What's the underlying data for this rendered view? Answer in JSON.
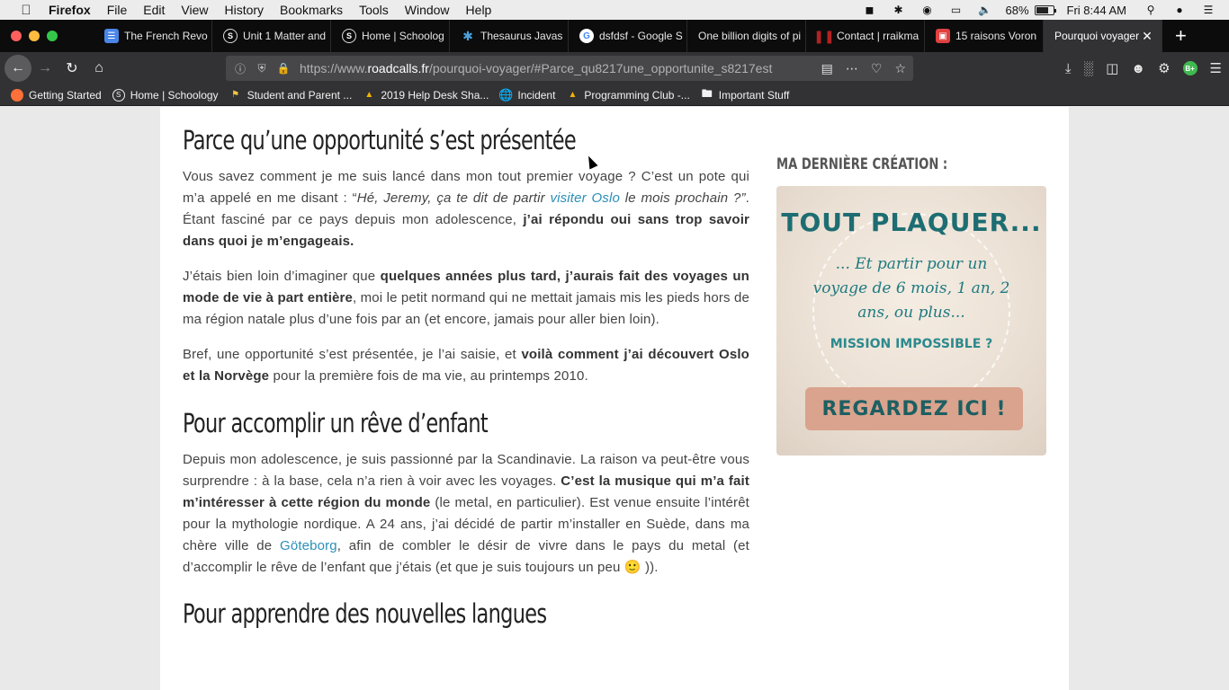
{
  "menubar": {
    "app": "Firefox",
    "items": [
      "File",
      "Edit",
      "View",
      "History",
      "Bookmarks",
      "Tools",
      "Window",
      "Help"
    ],
    "battery": "68%",
    "clock": "Fri 8:44 AM"
  },
  "tabs": [
    {
      "label": "The French Revo",
      "icon": "docs-icon",
      "color": "#4a86e8"
    },
    {
      "label": "Unit 1 Matter and",
      "icon": "schoology-icon",
      "color": "#3b3b3e"
    },
    {
      "label": "Home | Schoolog",
      "icon": "schoology-icon",
      "color": "#3b3b3e"
    },
    {
      "label": "Thesaurus Javas",
      "icon": "puzzle-icon",
      "color": "#4aa3df"
    },
    {
      "label": "dsfdsf - Google S",
      "icon": "google-icon",
      "color": "#ffffff"
    },
    {
      "label": "One billion digits of pi",
      "icon": "",
      "color": ""
    },
    {
      "label": "Contact | rraikma",
      "icon": "bars-icon",
      "color": "#b22222"
    },
    {
      "label": "15 raisons Voron",
      "icon": "photo-icon",
      "color": "#e04040"
    },
    {
      "label": "Pourquoi voyager",
      "icon": "",
      "color": "",
      "active": true
    }
  ],
  "urlbar": {
    "prefix": "https://www.",
    "domain": "roadcalls.fr",
    "path": "/pourquoi-voyager/#Parce_qu8217une_opportunite_s8217est"
  },
  "bookmarks": [
    {
      "label": "Getting Started",
      "icon": "firefox-icon"
    },
    {
      "label": "Home | Schoology",
      "icon": "schoology-icon"
    },
    {
      "label": "Student and Parent ...",
      "icon": "flag-icon"
    },
    {
      "label": "2019 Help Desk Sha...",
      "icon": "drive-icon"
    },
    {
      "label": "Incident",
      "icon": "globe-icon"
    },
    {
      "label": "Programming Club -...",
      "icon": "drive-icon"
    },
    {
      "label": "Important Stuff",
      "icon": "folder-icon"
    }
  ],
  "article": {
    "h1": "Parce qu’une opportunité s’est présentée",
    "p1": {
      "a": "Vous savez comment je me suis lancé dans mon tout premier voyage ? C’est un pote qui m’a appelé en me disant : “",
      "b": "Hé, Jeremy, ça te dit de partir ",
      "link": "visiter Oslo",
      "c": " le mois prochain ?”",
      "d": ". Étant fasciné par ce pays depuis mon adolescence, ",
      "e": "j’ai répondu oui sans trop savoir dans quoi je m’engageais."
    },
    "p2": {
      "a": "J’étais bien loin d’imaginer que ",
      "b": "quelques années plus tard, j’aurais fait des voyages un mode de vie à part entière",
      "c": ", moi le petit normand qui ne mettait jamais mis les pieds hors de ma région natale plus d’une fois par an (et encore, jamais pour aller bien loin)."
    },
    "p3": {
      "a": "Bref, une opportunité s’est présentée, je l’ai saisie, et ",
      "b": "voilà comment j’ai découvert Oslo et la Norvège",
      "c": " pour la première fois de ma vie, au printemps 2010."
    },
    "h2": "Pour accomplir un rêve d’enfant",
    "p4": {
      "a": "Depuis mon adolescence, je suis passionné par la Scandinavie. La raison va peut-être vous surprendre : à la base, cela n’a rien à voir avec les voyages. ",
      "b": "C’est la musique qui m’a fait m’intéresser à cette région du monde",
      "c": " (le metal, en particulier). Est venue ensuite l’intérêt pour la mythologie nordique. A 24 ans, j’ai décidé de partir m’installer en Suède, dans ma chère ville de ",
      "link": "Göteborg",
      "d": ", afin de combler le désir de vivre dans le pays du metal (et d’accomplir le rêve de l’enfant que j’étais (et que je suis toujours un peu ",
      "emoji": "🙂",
      "e": " ))."
    },
    "h3": "Pour apprendre des nouvelles langues"
  },
  "sidebar": {
    "title": "MA DERNIÈRE CRÉATION :",
    "promo": {
      "headline": "TOUT PLAQUER...",
      "subline": "... Et partir pour un voyage de 6 mois, 1 an, 2 ans, ou plus...",
      "question": "MISSION IMPOSSIBLE ?",
      "button": "REGARDEZ ICI !"
    }
  }
}
